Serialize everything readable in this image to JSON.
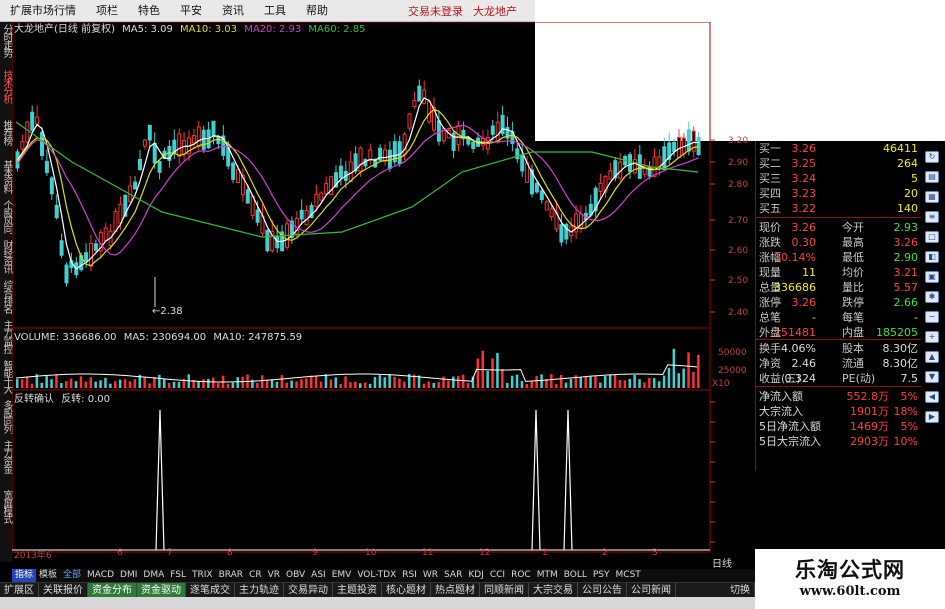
{
  "menu": {
    "items": [
      "扩展市场行情",
      "项栏",
      "特色",
      "平安",
      "资讯",
      "工具",
      "帮助"
    ],
    "status_login": "交易未登录",
    "status_stock": "大龙地产"
  },
  "left_tabs": [
    "分时走势",
    "技术分析",
    "推荐榜",
    "基本资料",
    "个股风向",
    "财经资讯",
    "综合排名",
    "主力监控",
    "智能十大",
    "多股同列",
    "主力资金",
    "宽屏模式"
  ],
  "price_panel": {
    "title": "大龙地产(日线 前复权)",
    "ma5": "MA5: 3.09",
    "ma10": "MA10: 3.03",
    "ma20": "MA20: 2.93",
    "ma60": "MA60: 2.85",
    "low_marker": "2.38",
    "y_ticks": [
      "3.20",
      "2.90",
      "2.80",
      "2.70",
      "2.60",
      "2.50",
      "2.40"
    ]
  },
  "volume_panel": {
    "title": "VOLUME: 336686.00",
    "ma5": "MA5: 230694.00",
    "ma10": "MA10: 247875.59",
    "y_ticks": [
      "50000",
      "25000",
      "X10"
    ]
  },
  "indicator_panel": {
    "title": "反转确认",
    "value": "反转: 0.00"
  },
  "x_labels": [
    "2013年6",
    "6",
    "7",
    "8",
    "9",
    "10",
    "11",
    "12",
    "1",
    "2",
    "3"
  ],
  "period_label": "日线",
  "quote": {
    "asks": [
      {
        "label": "买一",
        "price": "3.26",
        "vol": "46411"
      },
      {
        "label": "买二",
        "price": "3.25",
        "vol": "264"
      },
      {
        "label": "买三",
        "price": "3.24",
        "vol": "5"
      },
      {
        "label": "买四",
        "price": "3.23",
        "vol": "20"
      },
      {
        "label": "买五",
        "price": "3.22",
        "vol": "140"
      }
    ],
    "stats": [
      {
        "l1": "现价",
        "v1": "3.26",
        "l2": "今开",
        "v2": "2.93",
        "c1": "#ff4040",
        "c2": "#40e040"
      },
      {
        "l1": "涨跌",
        "v1": "0.30",
        "l2": "最高",
        "v2": "3.26",
        "c1": "#ff4040",
        "c2": "#ff4040"
      },
      {
        "l1": "涨幅",
        "v1": "10.14%",
        "l2": "最低",
        "v2": "2.90",
        "c1": "#ff4040",
        "c2": "#40e040"
      },
      {
        "l1": "现量",
        "v1": "11",
        "l2": "均价",
        "v2": "3.21",
        "c1": "#f0f000",
        "c2": "#ff4040"
      },
      {
        "l1": "总量",
        "v1": "336686",
        "l2": "量比",
        "v2": "5.57",
        "c1": "#f0f000",
        "c2": "#ff4040"
      },
      {
        "l1": "涨停",
        "v1": "3.26",
        "l2": "跌停",
        "v2": "2.66",
        "c1": "#ff4040",
        "c2": "#40e040"
      },
      {
        "l1": "总笔",
        "v1": "-",
        "l2": "每笔",
        "v2": "-",
        "c1": "#dddddd",
        "c2": "#dddddd"
      },
      {
        "l1": "外盘",
        "v1": "151481",
        "l2": "内盘",
        "v2": "185205",
        "c1": "#ff4040",
        "c2": "#40e040"
      }
    ],
    "fund": [
      {
        "l1": "换手",
        "v1": "4.06%",
        "l2": "股本",
        "v2": "8.30亿"
      },
      {
        "l1": "净资",
        "v1": "2.46",
        "l2": "流通",
        "v2": "8.30亿"
      },
      {
        "l1": "收益(三)",
        "v1": "0.324",
        "l2": "PE(动)",
        "v2": "7.5"
      }
    ],
    "flows": [
      {
        "label": "净流入额",
        "value": "552.8万",
        "pct": "5%"
      },
      {
        "label": "大宗流入",
        "value": "1901万",
        "pct": "18%"
      },
      {
        "label": "5日净流入额",
        "value": "1469万",
        "pct": "5%"
      },
      {
        "label": "5日大宗流入",
        "value": "2903万",
        "pct": "10%"
      }
    ]
  },
  "indicators": [
    "指标",
    "模板",
    "全部",
    "MACD",
    "DMI",
    "DMA",
    "FSL",
    "TRIX",
    "BRAR",
    "CR",
    "VR",
    "OBV",
    "ASI",
    "EMV",
    "VOL-TDX",
    "RSI",
    "WR",
    "SAR",
    "KDJ",
    "CCI",
    "ROC",
    "MTM",
    "BOLL",
    "PSY",
    "MCST"
  ],
  "bottom_tabs": [
    "扩展区",
    "关联报价",
    "资金分布",
    "资金驱动",
    "逐笔成交",
    "主力轨迹",
    "交易异动",
    "主题投资",
    "核心题材",
    "热点题材",
    "同顺新闻",
    "大宗交易",
    "公司公告",
    "公司新闻",
    "切换"
  ],
  "watermark": {
    "title": "乐淘公式网",
    "url": "www.60lt.com"
  },
  "colors": {
    "up": "#ff3030",
    "down": "#40d0d0",
    "ma5": "#ffffff",
    "ma10": "#e0e000",
    "ma20": "#d040d0",
    "ma60": "#30c030",
    "panel_border": "#a00000"
  }
}
